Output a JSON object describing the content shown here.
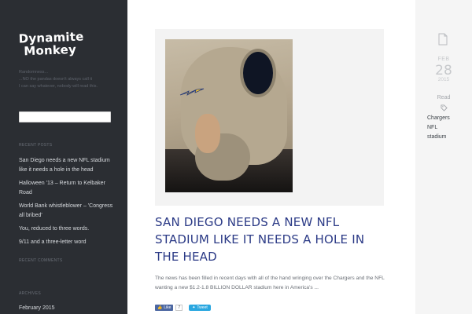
{
  "sidebar": {
    "logo_line1": "Dynamite",
    "logo_line2": "Monkey",
    "tagline": [
      "Randomness...",
      "...NO the pandas doesn't always call it",
      "I can say whatever, nobody will read this."
    ],
    "search_placeholder": "",
    "recent_posts_title": "RECENT POSTS",
    "recent_posts": [
      "San Diego needs a new NFL stadium like it needs a hole in the head",
      "Halloween '13 – Return to Kelbaker Road",
      "World Bank whistleblower – 'Congress all bribed'",
      "You, reduced to three words.",
      "9/11 and a three-letter word"
    ],
    "recent_comments_title": "RECENT COMMENTS",
    "archives_title": "ARCHIVES",
    "archive_first": "February 2015"
  },
  "post": {
    "title": "SAN DIEGO NEEDS A NEW NFL STADIUM LIKE IT NEEDS A HOLE IN THE HEAD",
    "excerpt": "The news has been filled in recent days with all of the hand wringing over the Chargers and the NFL wanting a new $1.2-1.8 BILLION DOLLAR stadium here in America's ...",
    "fb_label": "Like",
    "fb_count": "7",
    "tw_label": "Tweet"
  },
  "meta": {
    "month": "FEB",
    "day": "28",
    "year": "2015",
    "read_label": "Read",
    "tags": [
      "Chargers",
      "NFL",
      "stadium"
    ]
  },
  "colors": {
    "sidebar_bg": "#2b2e33",
    "title_blue": "#2b3a86",
    "fb_blue": "#4c67a1",
    "tw_blue": "#2aa7e0"
  }
}
